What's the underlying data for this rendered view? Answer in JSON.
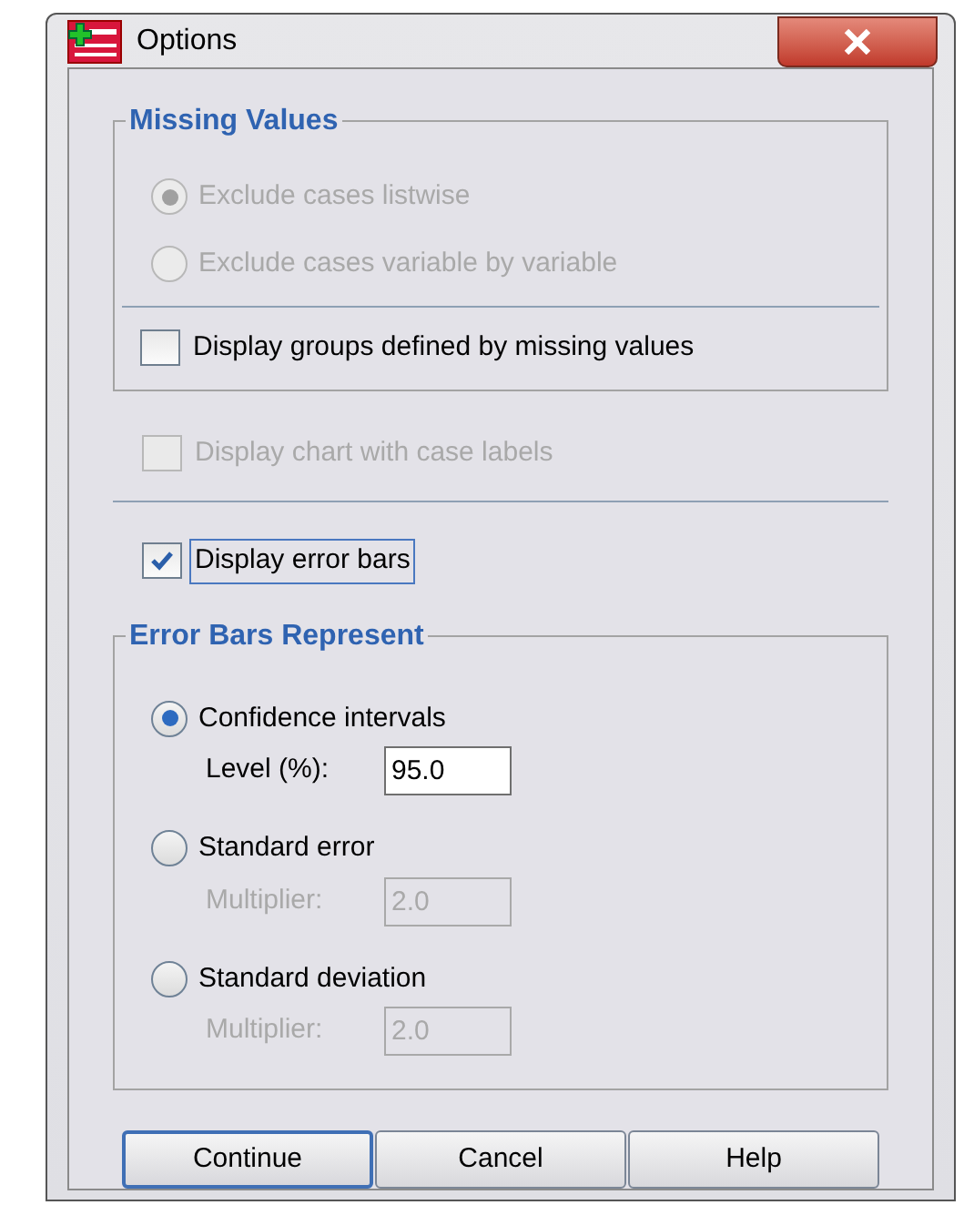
{
  "window": {
    "title": "Options"
  },
  "missing_values": {
    "title": "Missing Values",
    "options": [
      {
        "label": "Exclude cases listwise",
        "selected": true,
        "disabled": true
      },
      {
        "label": "Exclude cases variable by variable",
        "selected": false,
        "disabled": true
      }
    ],
    "checkbox": {
      "label": "Display groups defined by missing values",
      "checked": false,
      "disabled": false
    }
  },
  "chart_labels": {
    "label": "Display chart with case labels",
    "checked": false,
    "disabled": true
  },
  "error_bars": {
    "label": "Display error bars",
    "checked": true,
    "disabled": false,
    "focused": true
  },
  "error_bars_represent": {
    "title": "Error Bars Represent",
    "options": [
      {
        "label": "Confidence intervals",
        "selected": true,
        "field": {
          "label": "Level (%):",
          "value": "95.0",
          "disabled": false
        }
      },
      {
        "label": "Standard error",
        "selected": false,
        "field": {
          "label": "Multiplier:",
          "value": "2.0",
          "disabled": true
        }
      },
      {
        "label": "Standard deviation",
        "selected": false,
        "field": {
          "label": "Multiplier:",
          "value": "2.0",
          "disabled": true
        }
      }
    ]
  },
  "buttons": [
    {
      "label": "Continue",
      "default": true
    },
    {
      "label": "Cancel",
      "default": false
    },
    {
      "label": "Help",
      "default": false
    }
  ]
}
